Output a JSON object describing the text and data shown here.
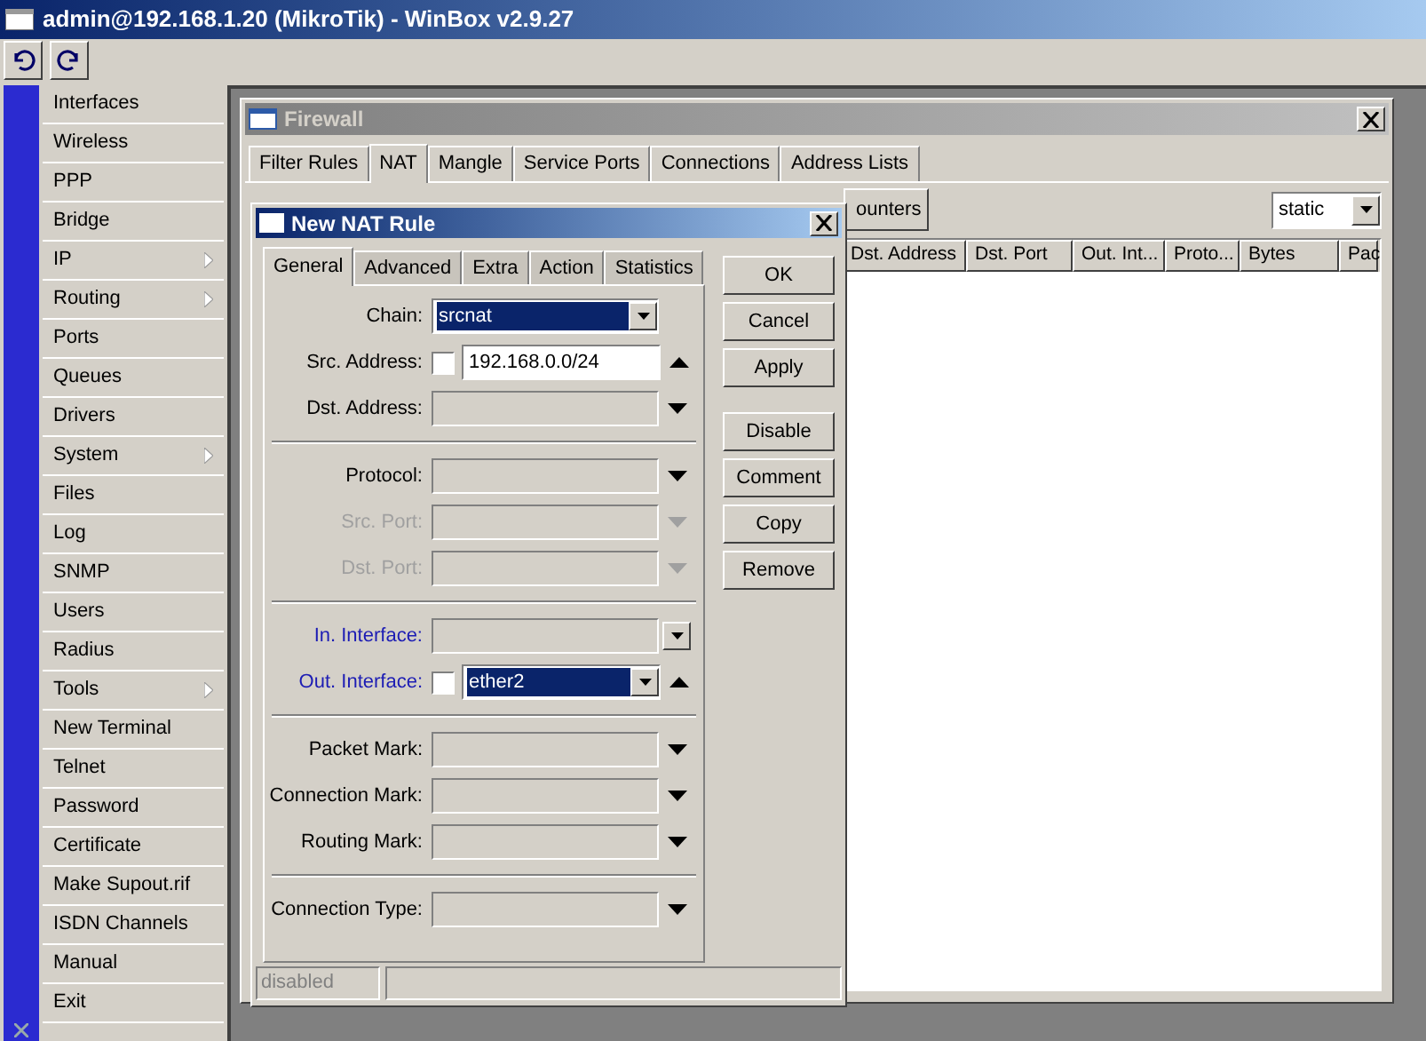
{
  "window": {
    "title": "admin@192.168.1.20 (MikroTik) - WinBox v2.9.27"
  },
  "toolbar": [
    {
      "kind": "undo"
    },
    {
      "kind": "redo"
    }
  ],
  "sidebar": {
    "items": [
      {
        "label": "Interfaces",
        "submenu": false
      },
      {
        "label": "Wireless",
        "submenu": false
      },
      {
        "label": "PPP",
        "submenu": false
      },
      {
        "label": "Bridge",
        "submenu": false
      },
      {
        "label": "IP",
        "submenu": true
      },
      {
        "label": "Routing",
        "submenu": true
      },
      {
        "label": "Ports",
        "submenu": false
      },
      {
        "label": "Queues",
        "submenu": false
      },
      {
        "label": "Drivers",
        "submenu": false
      },
      {
        "label": "System",
        "submenu": true
      },
      {
        "label": "Files",
        "submenu": false
      },
      {
        "label": "Log",
        "submenu": false
      },
      {
        "label": "SNMP",
        "submenu": false
      },
      {
        "label": "Users",
        "submenu": false
      },
      {
        "label": "Radius",
        "submenu": false
      },
      {
        "label": "Tools",
        "submenu": true
      },
      {
        "label": "New Terminal",
        "submenu": false
      },
      {
        "label": "Telnet",
        "submenu": false
      },
      {
        "label": "Password",
        "submenu": false
      },
      {
        "label": "Certificate",
        "submenu": false
      },
      {
        "label": "Make Supout.rif",
        "submenu": false
      },
      {
        "label": "ISDN Channels",
        "submenu": false
      },
      {
        "label": "Manual",
        "submenu": false
      },
      {
        "label": "Exit",
        "submenu": false
      }
    ]
  },
  "firewall": {
    "title": "Firewall",
    "tabs": [
      {
        "label": "Filter Rules",
        "selected": false
      },
      {
        "label": "NAT",
        "selected": true
      },
      {
        "label": "Mangle",
        "selected": false
      },
      {
        "label": "Service Ports",
        "selected": false
      },
      {
        "label": "Connections",
        "selected": false
      },
      {
        "label": "Address Lists",
        "selected": false
      }
    ],
    "toolbar_button": "ounters",
    "filter": "static",
    "columns": [
      "Dst. Address",
      "Dst. Port",
      "Out. Int...",
      "Proto...",
      "Bytes",
      "Pac"
    ]
  },
  "dialog": {
    "title": "New NAT Rule",
    "tabs": [
      {
        "label": "General",
        "selected": true
      },
      {
        "label": "Advanced",
        "selected": false
      },
      {
        "label": "Extra",
        "selected": false
      },
      {
        "label": "Action",
        "selected": false
      },
      {
        "label": "Statistics",
        "selected": false
      }
    ],
    "groups": [
      [
        {
          "label": "Chain:",
          "kind": "combo",
          "value": "srcnat",
          "highlighted": true,
          "disabled": false,
          "color": "#000000"
        },
        {
          "label": "Src. Address:",
          "kind": "field",
          "negate": false,
          "value": "192.168.0.0/24",
          "highlighted": false,
          "expanded": true,
          "disabled": false,
          "color": "#000000"
        },
        {
          "label": "Dst. Address:",
          "kind": "field",
          "expanded": false,
          "disabled": false,
          "color": "#000000"
        }
      ],
      [
        {
          "label": "Protocol:",
          "kind": "field",
          "expanded": false,
          "disabled": false,
          "color": "#000000"
        },
        {
          "label": "Src. Port:",
          "kind": "field",
          "expanded": false,
          "disabled": true,
          "color": "#a0a0a0"
        },
        {
          "label": "Dst. Port:",
          "kind": "field",
          "expanded": false,
          "disabled": true,
          "color": "#a0a0a0"
        }
      ],
      [
        {
          "label": "In. Interface:",
          "kind": "combo",
          "disabled": false,
          "color": "#1c1cb4"
        },
        {
          "label": "Out. Interface:",
          "kind": "combo",
          "negate": false,
          "value": "ether2",
          "highlighted": true,
          "expanded": true,
          "disabled": false,
          "color": "#1c1cb4"
        }
      ],
      [
        {
          "label": "Packet Mark:",
          "kind": "field",
          "expanded": false,
          "disabled": false,
          "color": "#000000"
        },
        {
          "label": "Connection Mark:",
          "kind": "field",
          "expanded": false,
          "disabled": false,
          "color": "#000000"
        },
        {
          "label": "Routing Mark:",
          "kind": "field",
          "expanded": false,
          "disabled": false,
          "color": "#000000"
        }
      ],
      [
        {
          "label": "Connection Type:",
          "kind": "field",
          "expanded": false,
          "disabled": false,
          "color": "#000000"
        }
      ]
    ],
    "buttons": [
      [
        "OK",
        "Cancel",
        "Apply"
      ],
      [
        "Disable",
        "Comment",
        "Copy",
        "Remove"
      ]
    ],
    "status": "disabled"
  }
}
